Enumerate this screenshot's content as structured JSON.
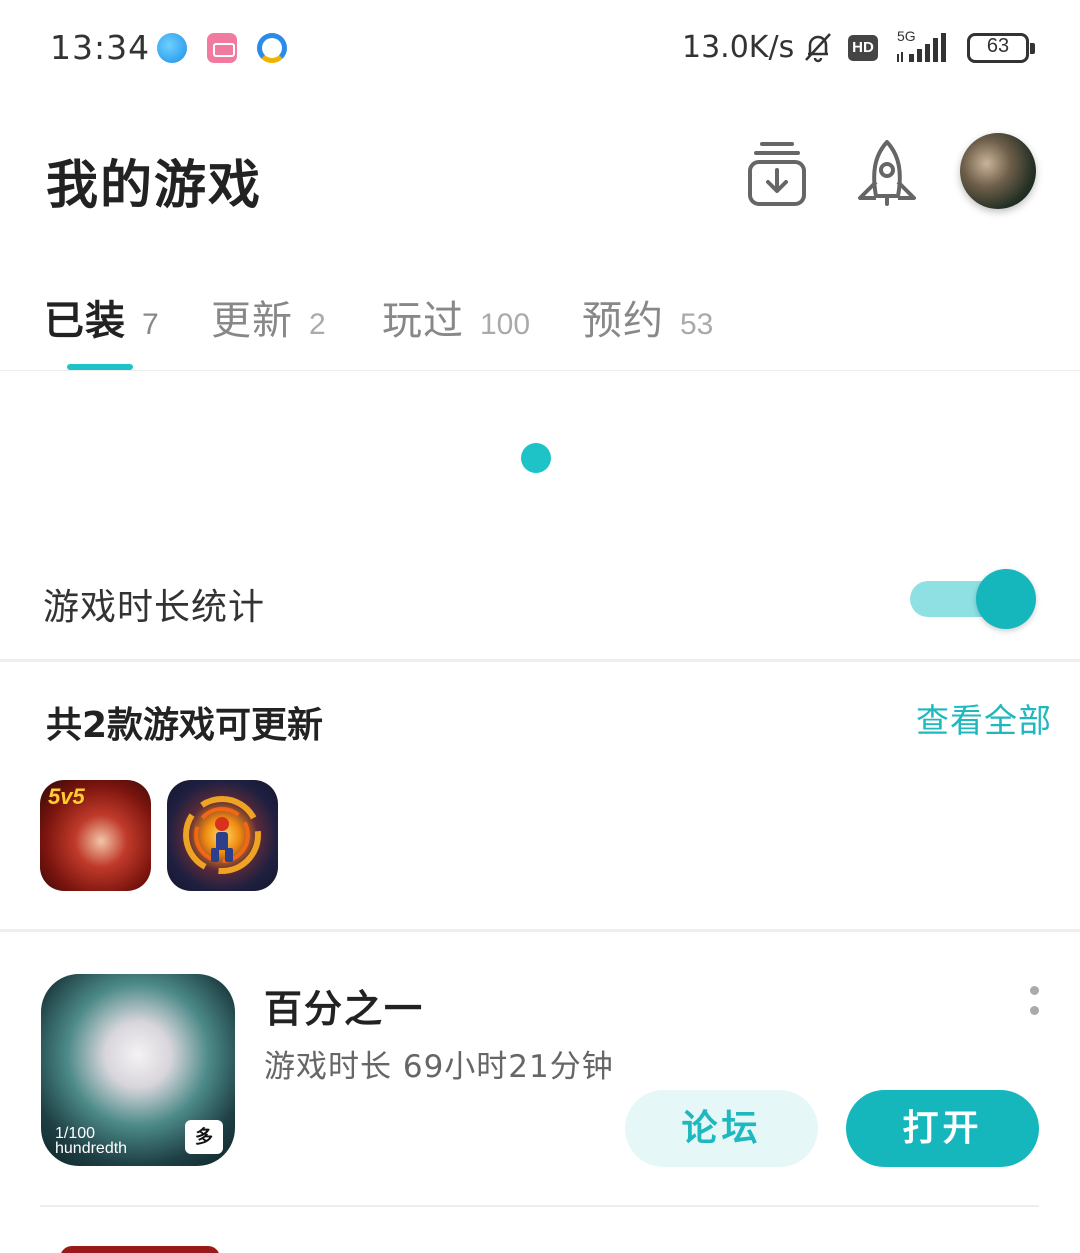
{
  "status_bar": {
    "time": "13:34",
    "network_speed": "13.0K/s",
    "hd_label": "HD",
    "network_type": "5G",
    "battery": "63",
    "app_icons": [
      "blue-orb-app-icon",
      "bilibili-app-icon",
      "qq-browser-app-icon"
    ]
  },
  "header": {
    "title": "我的游戏",
    "download_icon": "download-tray-icon",
    "rocket_icon": "rocket-icon"
  },
  "tabs": [
    {
      "label": "已装",
      "count": "7",
      "active": true
    },
    {
      "label": "更新",
      "count": "2",
      "active": false
    },
    {
      "label": "玩过",
      "count": "100",
      "active": false
    },
    {
      "label": "预约",
      "count": "53",
      "active": false
    }
  ],
  "stats": {
    "label": "游戏时长统计",
    "toggle_on": true
  },
  "updates": {
    "title": "共2款游戏可更新",
    "view_all": "查看全部",
    "icon_tag": "5v5"
  },
  "games": [
    {
      "name": "百分之一",
      "playtime": "游戏时长 69小时21分钟",
      "forum_label": "论坛",
      "open_label": "打开",
      "icon_logo": "1/100\nhundredth",
      "icon_mark": "多"
    }
  ],
  "colors": {
    "accent": "#1eb8be",
    "accent_dark": "#16b6bd",
    "accent_light": "#e6f7f8",
    "loader_secondary": "#f07a50"
  }
}
